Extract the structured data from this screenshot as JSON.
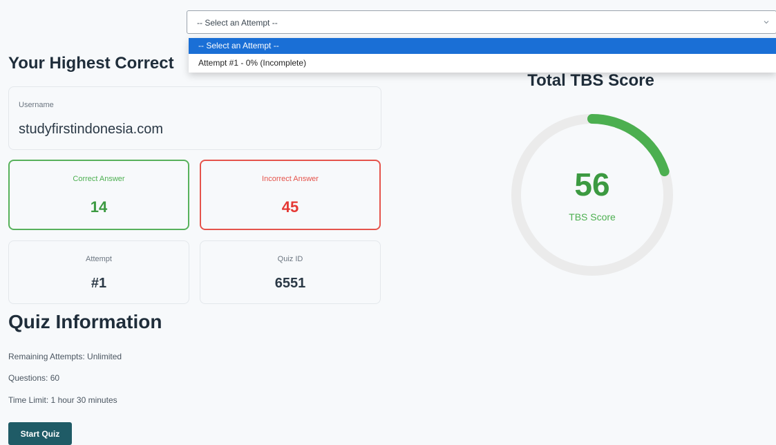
{
  "header": {
    "heading": "Your Highest Correct"
  },
  "attempt_select": {
    "selected": "-- Select an Attempt --",
    "options": [
      "-- Select an Attempt --",
      "Attempt #1 - 0% (Incomplete)"
    ]
  },
  "username_card": {
    "label": "Username",
    "value": "studyfirstindonesia.com"
  },
  "stats": {
    "correct": {
      "label": "Correct Answer",
      "value": "14"
    },
    "incorrect": {
      "label": "Incorrect Answer",
      "value": "45"
    },
    "attempt": {
      "label": "Attempt",
      "value": "#1"
    },
    "quiz_id": {
      "label": "Quiz ID",
      "value": "6551"
    }
  },
  "quiz_info": {
    "title": "Quiz Information",
    "remaining": "Remaining Attempts: Unlimited",
    "questions": "Questions: 60",
    "time_limit": "Time Limit: 1 hour 30 minutes",
    "start_button": "Start Quiz"
  },
  "tbs": {
    "title": "Total TBS Score",
    "score": "56",
    "caption": "TBS Score",
    "progress_fraction": 0.2
  },
  "colors": {
    "correct": "#4caf50",
    "incorrect": "#e5534b",
    "primary_button": "#1f5b66",
    "selected_option": "#1a6fd6",
    "gauge_track": "#ebebeb",
    "gauge_fill": "#4caf50"
  }
}
